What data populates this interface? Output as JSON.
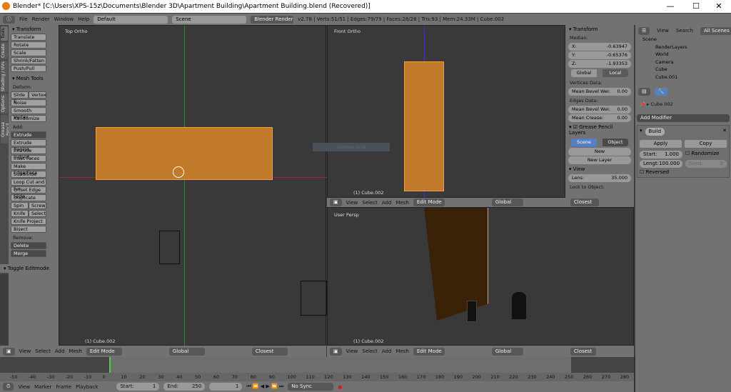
{
  "window": {
    "title": "Blender* [C:\\Users\\XPS-15z\\Documents\\Blender 3D\\Apartment Building\\Apartment Building.blend (Recovered)]",
    "min": "—",
    "max": "☐",
    "close": "✕"
  },
  "info_header": {
    "menus": [
      "File",
      "Render",
      "Window",
      "Help"
    ],
    "layout": "Default",
    "scene": "Scene",
    "engine": "Blender Render",
    "stats": "v2.78 | Verts:51/51 | Edges:79/79 | Faces:28/28 | Tris:93 | Mem:24.33M | Cube.002"
  },
  "tool_tabs": [
    "Tools",
    "Create",
    "Shading / UVs",
    "Options",
    "Grease Pencil"
  ],
  "tools": {
    "transform_title": "Transform",
    "transform": [
      "Translate",
      "Rotate",
      "Scale",
      "Shrink/Fatten",
      "Push/Pull"
    ],
    "mesh_tools_title": "Mesh Tools",
    "deform_label": "Deform:",
    "slide_e": "Slide E",
    "vertex": "Vertex",
    "deform": [
      "Noise",
      "Smooth Vertex",
      "Randomize"
    ],
    "add_label": "Add:",
    "extrude": "Extrude",
    "add": [
      "Extrude Region",
      "Extrude Individ...",
      "Inset Faces",
      "Make Edge/Face",
      "Subdivide",
      "Loop Cut and S...",
      "Offset Edge Slide",
      "Duplicate"
    ],
    "spin": "Spin",
    "screw": "Screw",
    "knife": "Knife",
    "select": "Select",
    "knife_project": "Knife Project",
    "bisect": "Bisect",
    "remove_label": "Remove:",
    "delete": "Delete",
    "merge": "Merge",
    "toggle_editmode": "Toggle Editmode"
  },
  "viewports": {
    "top": {
      "label": "Top Ortho",
      "object": "(1) Cube.002"
    },
    "front": {
      "label": "Front Ortho",
      "object": "(1) Cube.002"
    },
    "persp": {
      "label": "User Persp",
      "object": "(1) Cube.002"
    },
    "overlay": "Window Snip"
  },
  "view_header": {
    "menus": [
      "View",
      "Select",
      "Add",
      "Mesh"
    ],
    "mode": "Edit Mode",
    "orientation": "Global",
    "snap": "Closest"
  },
  "n_panel": {
    "transform_title": "Transform",
    "median": "Median:",
    "x_label": "X:",
    "x": "-0.63947",
    "y_label": "Y:",
    "y": "-0.65376",
    "z_label": "Z:",
    "z": "-1.93353",
    "global": "Global",
    "local": "Local",
    "vertices_data": "Vertices Data:",
    "mean_bevel_label": "Mean Bevel Wei:",
    "v_bevel": "0.00",
    "edges_data": "Edges Data:",
    "e_bevel": "0.00",
    "mean_crease_label": "Mean Crease:",
    "crease": "0.00",
    "gp_title": "Grease Pencil Layers",
    "scene": "Scene",
    "object": "Object",
    "new": "New",
    "new_layer": "New Layer",
    "view_title": "View",
    "lens_label": "Lens:",
    "lens": "35.000",
    "lock_label": "Lock to Object:"
  },
  "outliner": {
    "view": "View",
    "search": "Search",
    "filter": "All Scenes",
    "items": [
      "Scene",
      "RenderLayers",
      "World",
      "Camera",
      "Cube",
      "Cube.001"
    ]
  },
  "properties": {
    "object": "Cube.002",
    "add_modifier": "Add Modifier",
    "modifier": "Build",
    "apply": "Apply",
    "copy": "Copy",
    "start_label": "Start:",
    "start": "1.000",
    "length_label": "Lengt:",
    "length": "100.000",
    "randomize": "Randomize",
    "seed_label": "Seed:",
    "seed": "0",
    "reversed": "Reversed"
  },
  "timeline": {
    "ticks": [
      "-50",
      "-40",
      "-30",
      "-20",
      "-10",
      "0",
      "10",
      "20",
      "30",
      "40",
      "50",
      "60",
      "70",
      "80",
      "90",
      "100",
      "110",
      "120",
      "130",
      "140",
      "150",
      "160",
      "170",
      "180",
      "190",
      "200",
      "210",
      "220",
      "230",
      "240",
      "250",
      "260",
      "270",
      "280"
    ],
    "menus": [
      "View",
      "Marker",
      "Frame",
      "Playback"
    ],
    "start_label": "Start:",
    "start": "1",
    "end_label": "End:",
    "end": "250",
    "current": "1",
    "sync": "No Sync"
  },
  "colors": {
    "accent": "#5680c2",
    "selection": "#e8912c"
  }
}
